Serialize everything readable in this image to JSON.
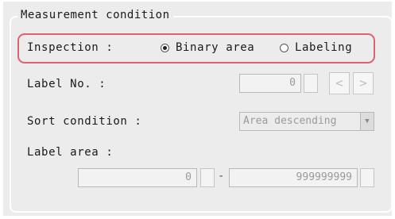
{
  "group": {
    "title": "Measurement condition"
  },
  "inspection": {
    "label": "Inspection :",
    "options": [
      "Binary area",
      "Labeling"
    ],
    "selected": "Binary area"
  },
  "label_no": {
    "label": "Label No. :",
    "value": "0",
    "prev": "<",
    "next": ">"
  },
  "sort_condition": {
    "label": "Sort condition :",
    "value": "Area descending"
  },
  "label_area": {
    "label": "Label area :",
    "min": "0",
    "separator": "-",
    "max": "999999999"
  }
}
